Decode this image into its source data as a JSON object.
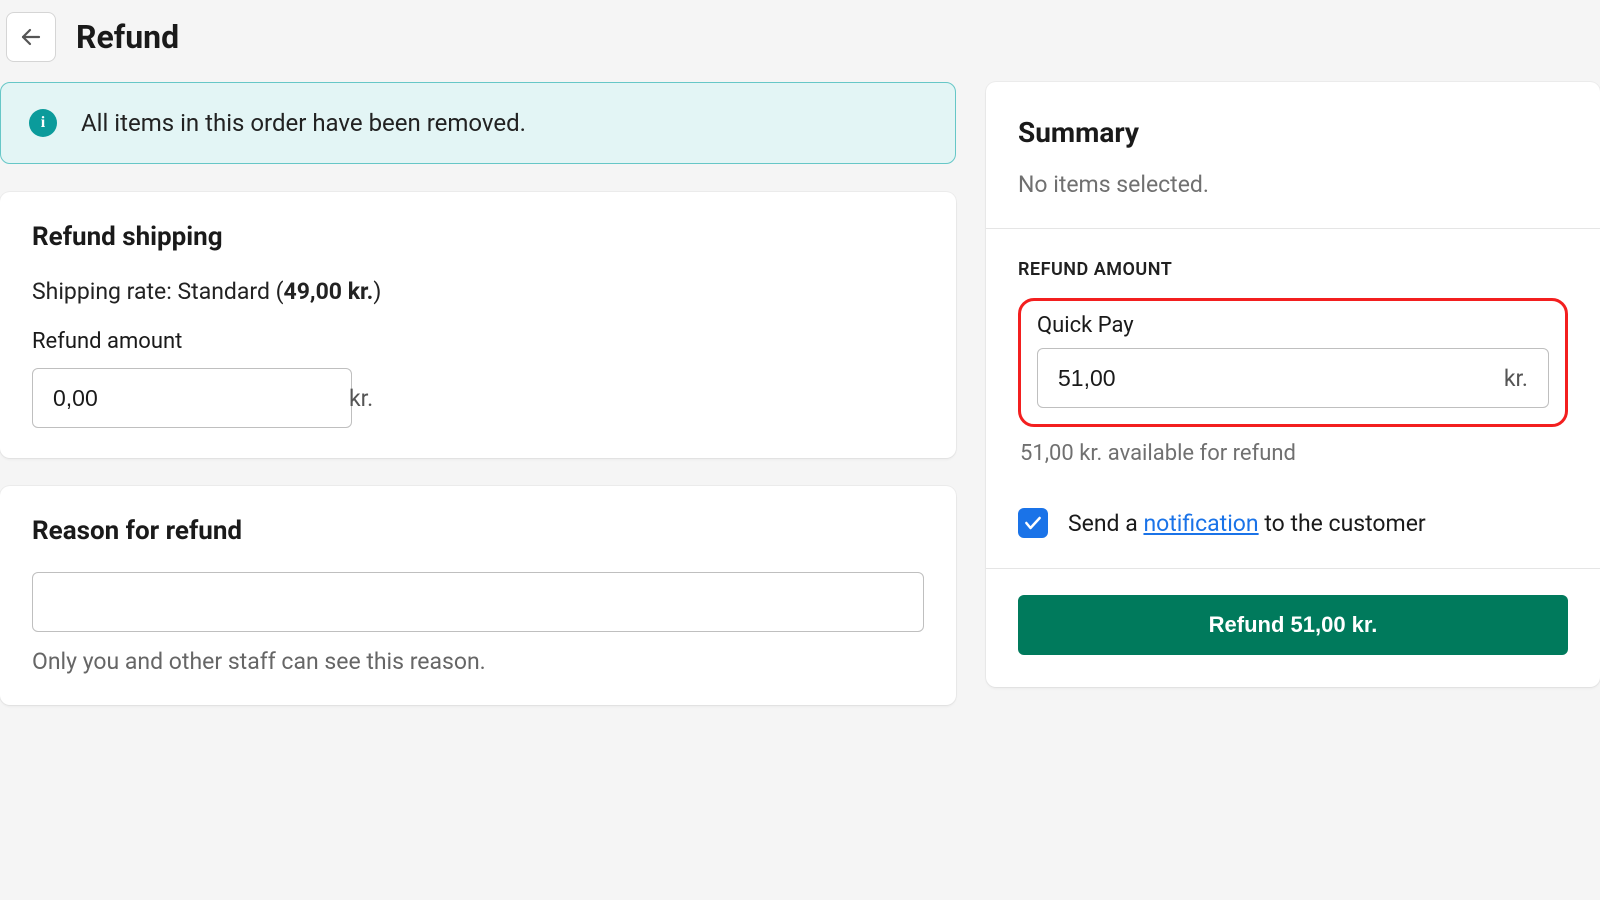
{
  "header": {
    "title": "Refund"
  },
  "banner": {
    "icon_glyph": "i",
    "text": "All items in this order have been removed."
  },
  "shipping": {
    "title": "Refund shipping",
    "rate_prefix": "Shipping rate: Standard (",
    "rate_price": "49,00 kr.",
    "rate_suffix": ")",
    "amount_label": "Refund amount",
    "amount_value": "0,00",
    "currency_suffix": "kr."
  },
  "reason": {
    "title": "Reason for refund",
    "value": "",
    "hint": "Only you and other staff can see this reason."
  },
  "summary": {
    "title": "Summary",
    "empty_text": "No items selected.",
    "amount_heading": "REFUND AMOUNT",
    "gateway_label": "Quick Pay",
    "amount_value": "51,00",
    "currency_suffix": "kr.",
    "available_text": "51,00 kr. available for refund",
    "notify_prefix": "Send a ",
    "notify_link": "notification",
    "notify_suffix": " to the customer",
    "notify_checked": true,
    "button_label": "Refund 51,00 kr."
  }
}
